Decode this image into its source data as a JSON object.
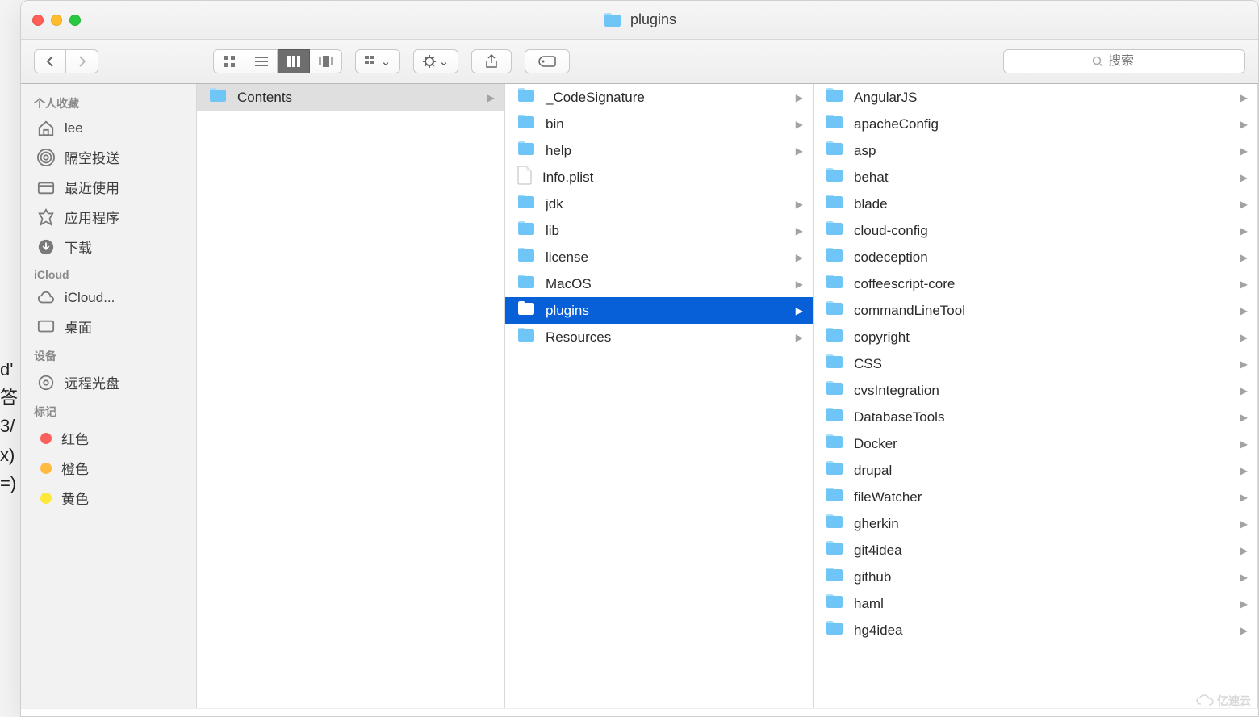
{
  "window": {
    "title": "plugins"
  },
  "toolbar": {
    "search_placeholder": "搜索"
  },
  "sidebar": {
    "sections": [
      {
        "header": "个人收藏",
        "items": [
          {
            "icon": "home-icon",
            "label": "lee"
          },
          {
            "icon": "airdrop-icon",
            "label": "隔空投送"
          },
          {
            "icon": "recents-icon",
            "label": "最近使用"
          },
          {
            "icon": "apps-icon",
            "label": "应用程序"
          },
          {
            "icon": "downloads-icon",
            "label": "下载"
          }
        ]
      },
      {
        "header": "iCloud",
        "items": [
          {
            "icon": "cloud-icon",
            "label": "iCloud..."
          },
          {
            "icon": "desktop-icon",
            "label": "桌面"
          }
        ]
      },
      {
        "header": "设备",
        "items": [
          {
            "icon": "disc-icon",
            "label": "远程光盘"
          }
        ]
      },
      {
        "header": "标记",
        "items": [
          {
            "icon": "tag-red",
            "label": "红色",
            "color": "#fc605c"
          },
          {
            "icon": "tag-orange",
            "label": "橙色",
            "color": "#fdbc40"
          },
          {
            "icon": "tag-yellow",
            "label": "黄色",
            "color": "#fce83a"
          }
        ]
      }
    ]
  },
  "columns": [
    {
      "items": [
        {
          "name": "Contents",
          "type": "folder",
          "hasChildren": true,
          "selected": true
        }
      ]
    },
    {
      "items": [
        {
          "name": "_CodeSignature",
          "type": "folder",
          "hasChildren": true
        },
        {
          "name": "bin",
          "type": "folder",
          "hasChildren": true
        },
        {
          "name": "help",
          "type": "folder",
          "hasChildren": true
        },
        {
          "name": "Info.plist",
          "type": "file",
          "hasChildren": false
        },
        {
          "name": "jdk",
          "type": "folder",
          "hasChildren": true
        },
        {
          "name": "lib",
          "type": "folder",
          "hasChildren": true
        },
        {
          "name": "license",
          "type": "folder",
          "hasChildren": true
        },
        {
          "name": "MacOS",
          "type": "folder",
          "hasChildren": true
        },
        {
          "name": "plugins",
          "type": "folder",
          "hasChildren": true,
          "active": true
        },
        {
          "name": "Resources",
          "type": "folder",
          "hasChildren": true
        }
      ]
    },
    {
      "items": [
        {
          "name": "AngularJS",
          "type": "folder",
          "hasChildren": true
        },
        {
          "name": "apacheConfig",
          "type": "folder",
          "hasChildren": true
        },
        {
          "name": "asp",
          "type": "folder",
          "hasChildren": true
        },
        {
          "name": "behat",
          "type": "folder",
          "hasChildren": true
        },
        {
          "name": "blade",
          "type": "folder",
          "hasChildren": true
        },
        {
          "name": "cloud-config",
          "type": "folder",
          "hasChildren": true
        },
        {
          "name": "codeception",
          "type": "folder",
          "hasChildren": true
        },
        {
          "name": "coffeescript-core",
          "type": "folder",
          "hasChildren": true
        },
        {
          "name": "commandLineTool",
          "type": "folder",
          "hasChildren": true
        },
        {
          "name": "copyright",
          "type": "folder",
          "hasChildren": true
        },
        {
          "name": "CSS",
          "type": "folder",
          "hasChildren": true
        },
        {
          "name": "cvsIntegration",
          "type": "folder",
          "hasChildren": true
        },
        {
          "name": "DatabaseTools",
          "type": "folder",
          "hasChildren": true
        },
        {
          "name": "Docker",
          "type": "folder",
          "hasChildren": true
        },
        {
          "name": "drupal",
          "type": "folder",
          "hasChildren": true
        },
        {
          "name": "fileWatcher",
          "type": "folder",
          "hasChildren": true
        },
        {
          "name": "gherkin",
          "type": "folder",
          "hasChildren": true
        },
        {
          "name": "git4idea",
          "type": "folder",
          "hasChildren": true
        },
        {
          "name": "github",
          "type": "folder",
          "hasChildren": true
        },
        {
          "name": "haml",
          "type": "folder",
          "hasChildren": true
        },
        {
          "name": "hg4idea",
          "type": "folder",
          "hasChildren": true
        }
      ]
    }
  ],
  "watermark": "亿速云",
  "left_fragment": [
    "d'",
    "答",
    "3/",
    "x)",
    "=)"
  ]
}
